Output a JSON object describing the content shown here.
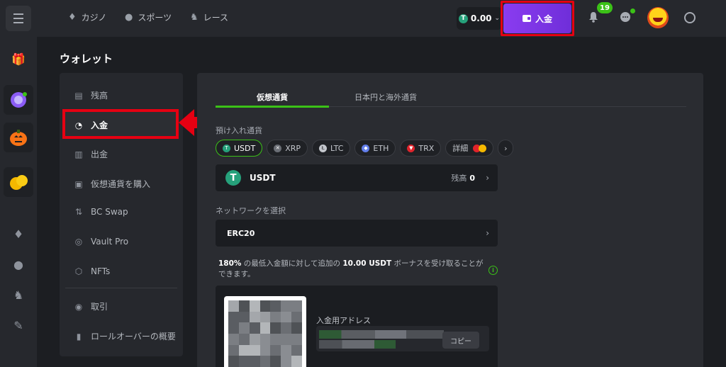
{
  "topnav": {
    "items": [
      {
        "label": "カジノ",
        "icon": "casino-icon"
      },
      {
        "label": "スポーツ",
        "icon": "sports-icon"
      },
      {
        "label": "レース",
        "icon": "racing-icon"
      }
    ],
    "balance": "0.00",
    "deposit_label": "入金",
    "notification_count": "19"
  },
  "page": {
    "title": "ウォレット"
  },
  "wallet_menu": {
    "items": [
      {
        "label": "残高",
        "icon": "balance-icon"
      },
      {
        "label": "入金",
        "icon": "piggy-bank-icon",
        "active": true
      },
      {
        "label": "出金",
        "icon": "withdraw-icon"
      },
      {
        "label": "仮想通貨を購入",
        "icon": "buy-crypto-icon"
      },
      {
        "label": "BC Swap",
        "icon": "swap-icon"
      },
      {
        "label": "Vault Pro",
        "icon": "vault-icon"
      },
      {
        "label": "NFTs",
        "icon": "nft-icon"
      },
      {
        "label": "取引",
        "icon": "transactions-icon"
      },
      {
        "label": "ロールオーバーの概要",
        "icon": "rollover-icon"
      }
    ]
  },
  "deposit": {
    "tabs": [
      "仮想通貨",
      "日本円と海外通貨"
    ],
    "currency_label": "預け入れ通貨",
    "currency_chips": [
      {
        "label": "USDT",
        "color": "#26a17b",
        "selected": true
      },
      {
        "label": "XRP",
        "color": "#6b6f76"
      },
      {
        "label": "LTC",
        "color": "#c3c6cc"
      },
      {
        "label": "ETH",
        "color": "#627eea"
      },
      {
        "label": "TRX",
        "color": "#e0232b"
      },
      {
        "label": "詳細",
        "color": "#e0232b"
      }
    ],
    "selected_currency": "USDT",
    "balance_label": "残高",
    "balance_value": "0",
    "network_label": "ネットワークを選択",
    "network_value": "ERC20",
    "bonus": {
      "percent": "180%",
      "text1": "の最低入金額に対して追加の",
      "amount": "10.00 USDT",
      "text2": "ボーナスを受け取ることができます。"
    },
    "address_label": "入金用アドレス",
    "copy_label": "コピー"
  },
  "colors": {
    "accent_green": "#3bc117",
    "deposit_purple": "#7b35e2",
    "highlight_red": "#e60012"
  }
}
